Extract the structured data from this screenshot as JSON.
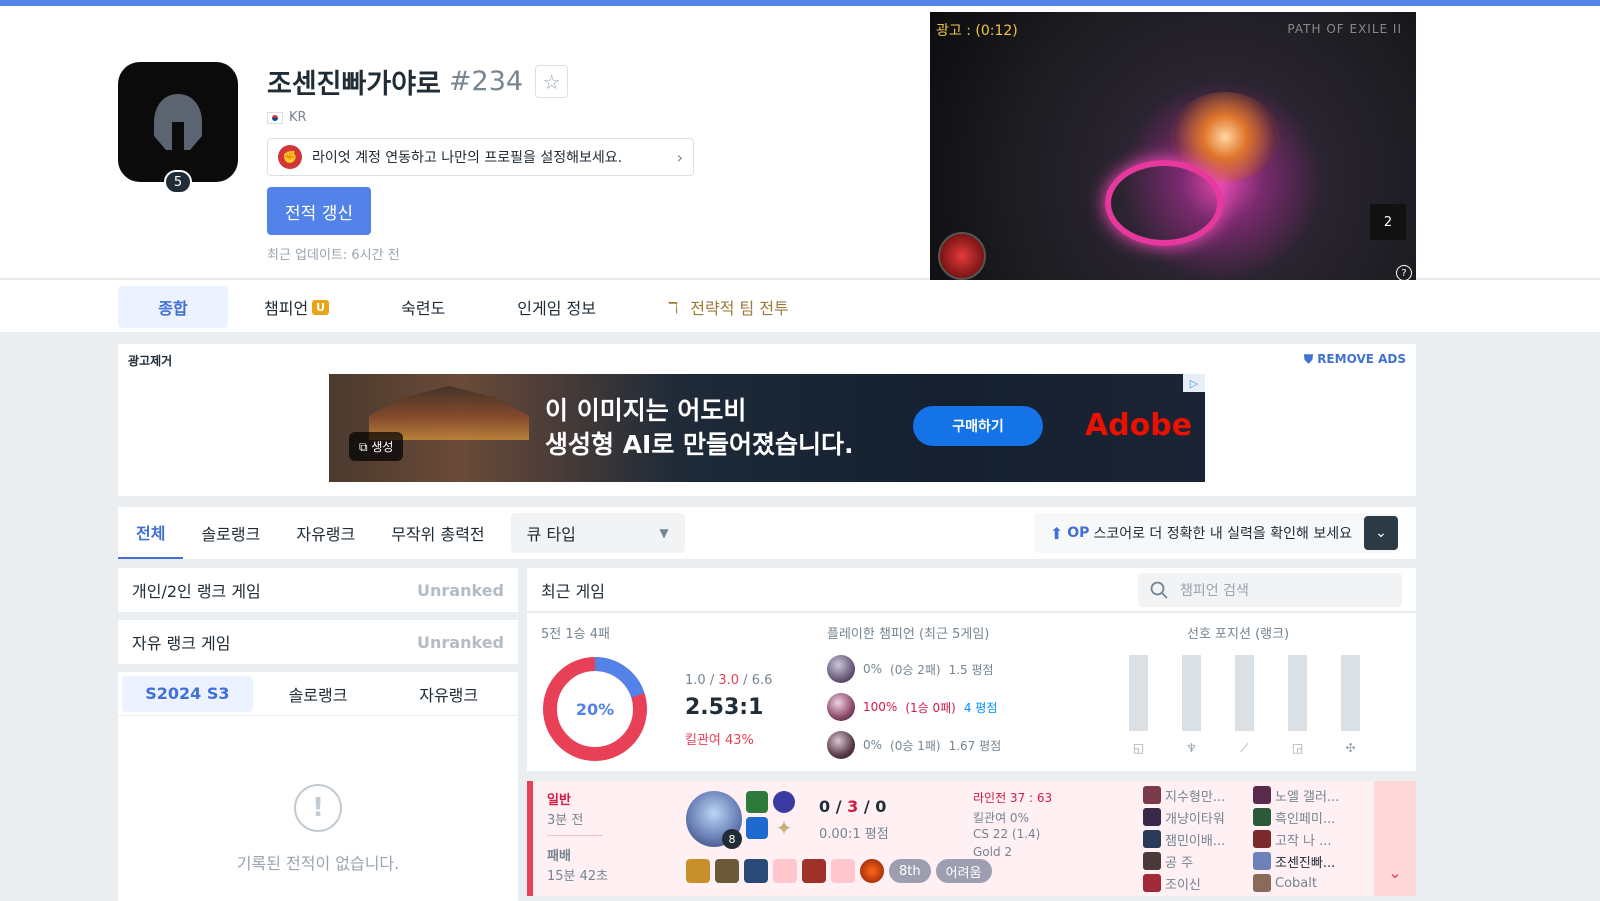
{
  "profile": {
    "name": "조센진빠가야로",
    "tag": "#234",
    "level": "5",
    "region": "KR",
    "riot_link_text": "라이엇 계정 연동하고 나만의 프로필을 설정해보세요.",
    "renew_label": "전적 갱신",
    "updated": "최근 업데이트: 6시간 전"
  },
  "video_ad": {
    "label": "광고 : (0:12)",
    "brand": "PATH OF EXILE II",
    "count": "2",
    "help": "?"
  },
  "nav": {
    "tabs": [
      {
        "label": "종합",
        "active": true
      },
      {
        "label": "챔피언",
        "badge": "U"
      },
      {
        "label": "숙련도"
      },
      {
        "label": "인게임 정보"
      },
      {
        "label": "전략적 팀 전투"
      }
    ]
  },
  "ad_box": {
    "label": "광고제거",
    "remove": "REMOVE ADS",
    "headline_1": "이 이미지는 어도비",
    "headline_2": "생성형 AI로 만들어졌습니다.",
    "buy": "구매하기",
    "brand": "Adobe",
    "gen": "생성"
  },
  "filter": {
    "tabs": [
      "전체",
      "솔로랭크",
      "자유랭크",
      "무작위 총력전"
    ],
    "active_index": 0,
    "queue_label": "큐 타입",
    "op_prefix": "OP",
    "op_text": "스코어로 더 정확한 내 실력을 확인해 보세요"
  },
  "ranks": [
    {
      "title": "개인/2인 랭크 게임",
      "status": "Unranked"
    },
    {
      "title": "자유 랭크 게임",
      "status": "Unranked"
    }
  ],
  "season": {
    "tabs": [
      "S2024 S3",
      "솔로랭크",
      "자유랭크"
    ],
    "empty_text": "기록된 전적이 없습니다.",
    "exclaim": "!"
  },
  "recent": {
    "title": "최근 게임",
    "search_placeholder": "챔피언 검색"
  },
  "summary": {
    "record": "5전 1승 4패",
    "winrate_percent": 20,
    "winrate_label": "20%",
    "kills": "1.0",
    "deaths": "3.0",
    "assists": "6.6",
    "ratio": "2.53:1",
    "kill_participation": "킬관여 43%",
    "champ_title": "플레이한 챔피언 (최근 5게임)",
    "pos_title": "선호 포지션 (랭크)",
    "champions": [
      {
        "wr": "0%",
        "rec": "(0승 2패)",
        "kda": "1.5 평점",
        "wr_color": "gray",
        "kda_color": "gray"
      },
      {
        "wr": "100%",
        "rec": "(1승 0패)",
        "kda": "4 평점",
        "wr_color": "red",
        "kda_color": "blue"
      },
      {
        "wr": "0%",
        "rec": "(0승 1패)",
        "kda": "1.67 평점",
        "wr_color": "gray",
        "kda_color": "gray"
      }
    ],
    "positions": [
      {
        "icon": "top-icon",
        "glyph": "◱",
        "value": 0
      },
      {
        "icon": "jungle-icon",
        "glyph": "♆",
        "value": 0
      },
      {
        "icon": "mid-icon",
        "glyph": "⟋",
        "value": 0
      },
      {
        "icon": "bottom-icon",
        "glyph": "◲",
        "value": 0
      },
      {
        "icon": "support-icon",
        "glyph": "✣",
        "value": 0
      }
    ]
  },
  "game": {
    "type": "일반",
    "ago": "3분 전",
    "result": "패배",
    "duration": "15분 42초",
    "level": "8",
    "kills": "0",
    "deaths": "3",
    "assists": "0",
    "kda_ratio": "0.00:1 평점",
    "lane": "라인전 37 : 63",
    "kp": "킬관여 0%",
    "cs": "CS 22 (1.4)",
    "tier": "Gold 2",
    "placement": "8th",
    "difficulty": "어려움",
    "team1": [
      "지수형만...",
      "개냥이타워",
      "잼민이배...",
      "공 주",
      "조이신"
    ],
    "team2": [
      "노엘 갤러...",
      "흑인페미...",
      "고작 나 ...",
      "조센진빠...",
      "Cobalt"
    ],
    "expand": "⌄"
  },
  "colors": {
    "accent": "#5383e8",
    "loss": "#e84057",
    "win": "#5383e8"
  }
}
